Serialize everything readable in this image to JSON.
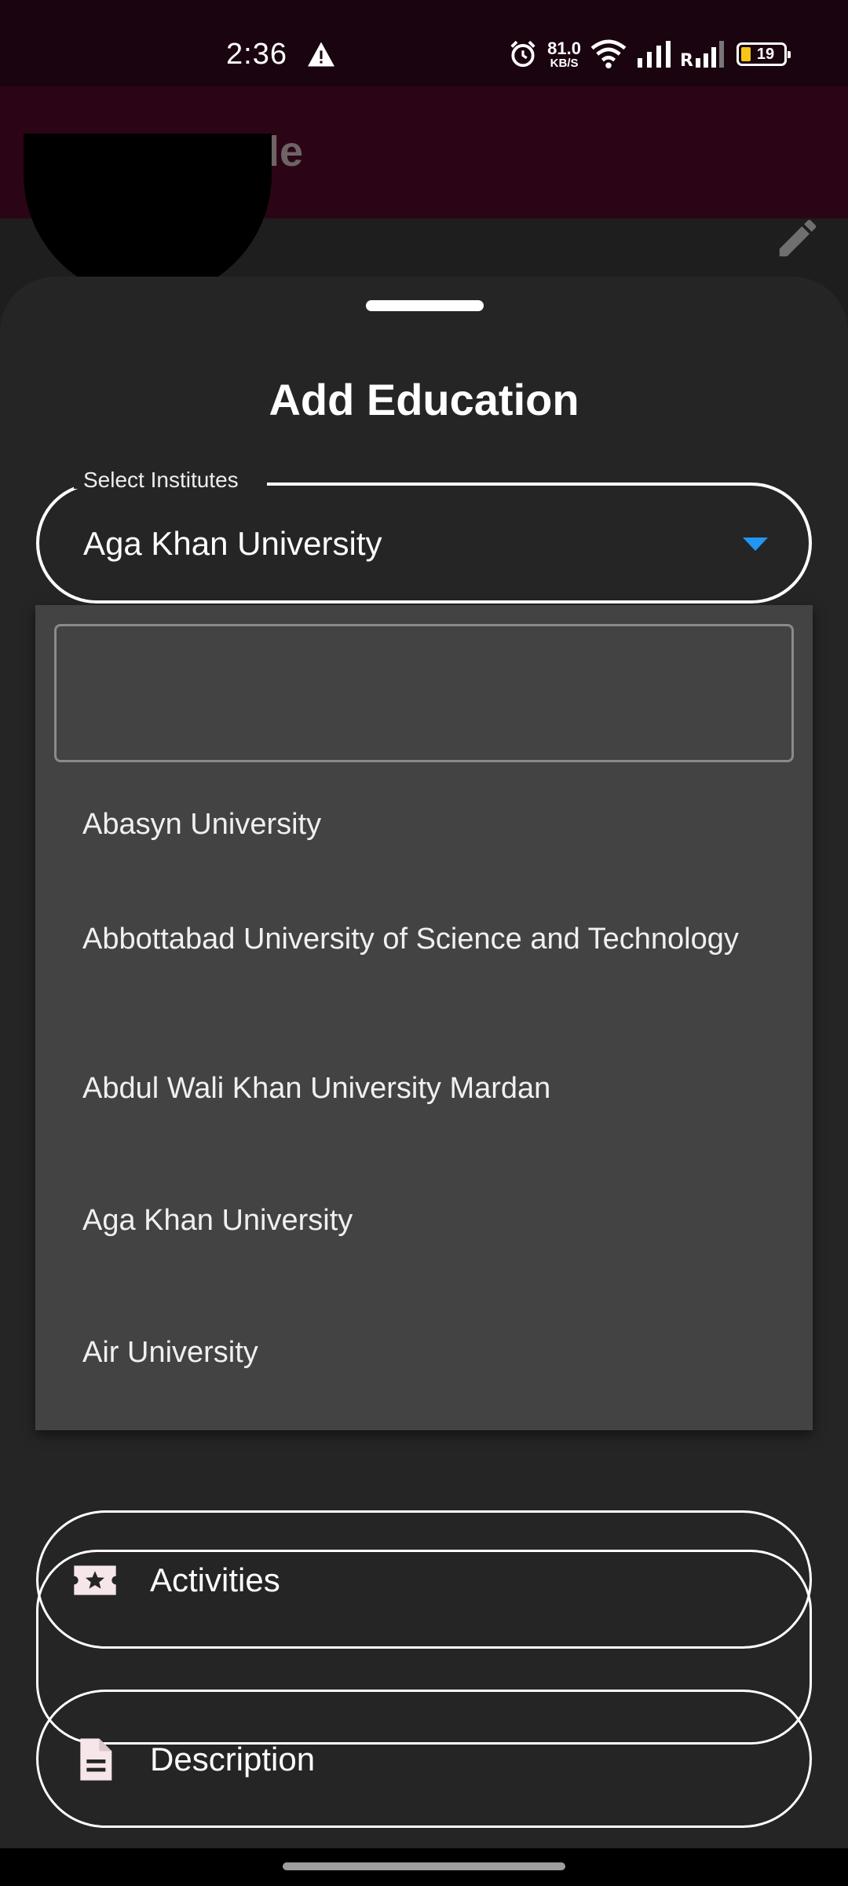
{
  "status_bar": {
    "time": "2:36",
    "net_speed_value": "81.0",
    "net_speed_unit": "KB/S",
    "battery_level": "19",
    "icons": [
      "warning-icon",
      "alarm-icon",
      "wifi-icon",
      "signal-icon",
      "signal-roaming-icon",
      "battery-icon"
    ]
  },
  "app_bar": {
    "title": "Profile",
    "menu_icon": "menu-icon"
  },
  "sheet": {
    "title": "Add Education",
    "institute_field": {
      "label": "Select Institutes",
      "value": "Aga Khan University",
      "caret_color": "#2196f3"
    },
    "dropdown": {
      "search_value": "",
      "items": [
        "Abasyn University",
        "Abbottabad University of Science and Technology",
        "Abdul Wali Khan University Mardan",
        "Aga Khan University",
        "Air University"
      ]
    },
    "activities": {
      "label": "Activities",
      "icon": "ticket-star-icon"
    },
    "description": {
      "label": "Description",
      "icon": "document-icon"
    }
  },
  "colors": {
    "status_bar_bg": "#1a0410",
    "app_bar_bg": "#2b0516",
    "sheet_bg": "#252525",
    "dropdown_bg": "#434343",
    "accent": "#2196f3",
    "battery_fill": "#f5c518"
  }
}
